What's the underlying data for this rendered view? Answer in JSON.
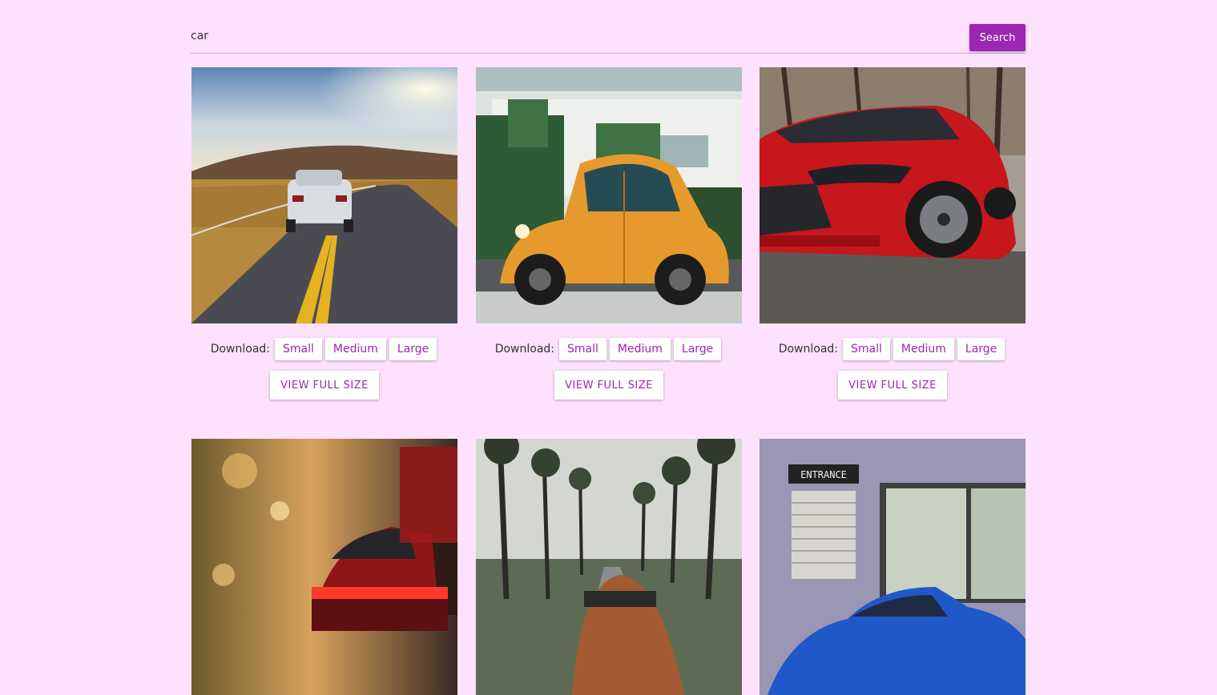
{
  "search": {
    "value": "car",
    "button_label": "Search"
  },
  "results": [
    {
      "download_label": "Download:",
      "sizes": [
        "Small",
        "Medium",
        "Large"
      ],
      "view_label": "VIEW FULL SIZE"
    },
    {
      "download_label": "Download:",
      "sizes": [
        "Small",
        "Medium",
        "Large"
      ],
      "view_label": "VIEW FULL SIZE"
    },
    {
      "download_label": "Download:",
      "sizes": [
        "Small",
        "Medium",
        "Large"
      ],
      "view_label": "VIEW FULL SIZE"
    },
    {},
    {},
    {
      "sign_text": "ENTRANCE"
    }
  ],
  "colors": {
    "background": "#fde1fd",
    "accent": "#9c27b0"
  }
}
